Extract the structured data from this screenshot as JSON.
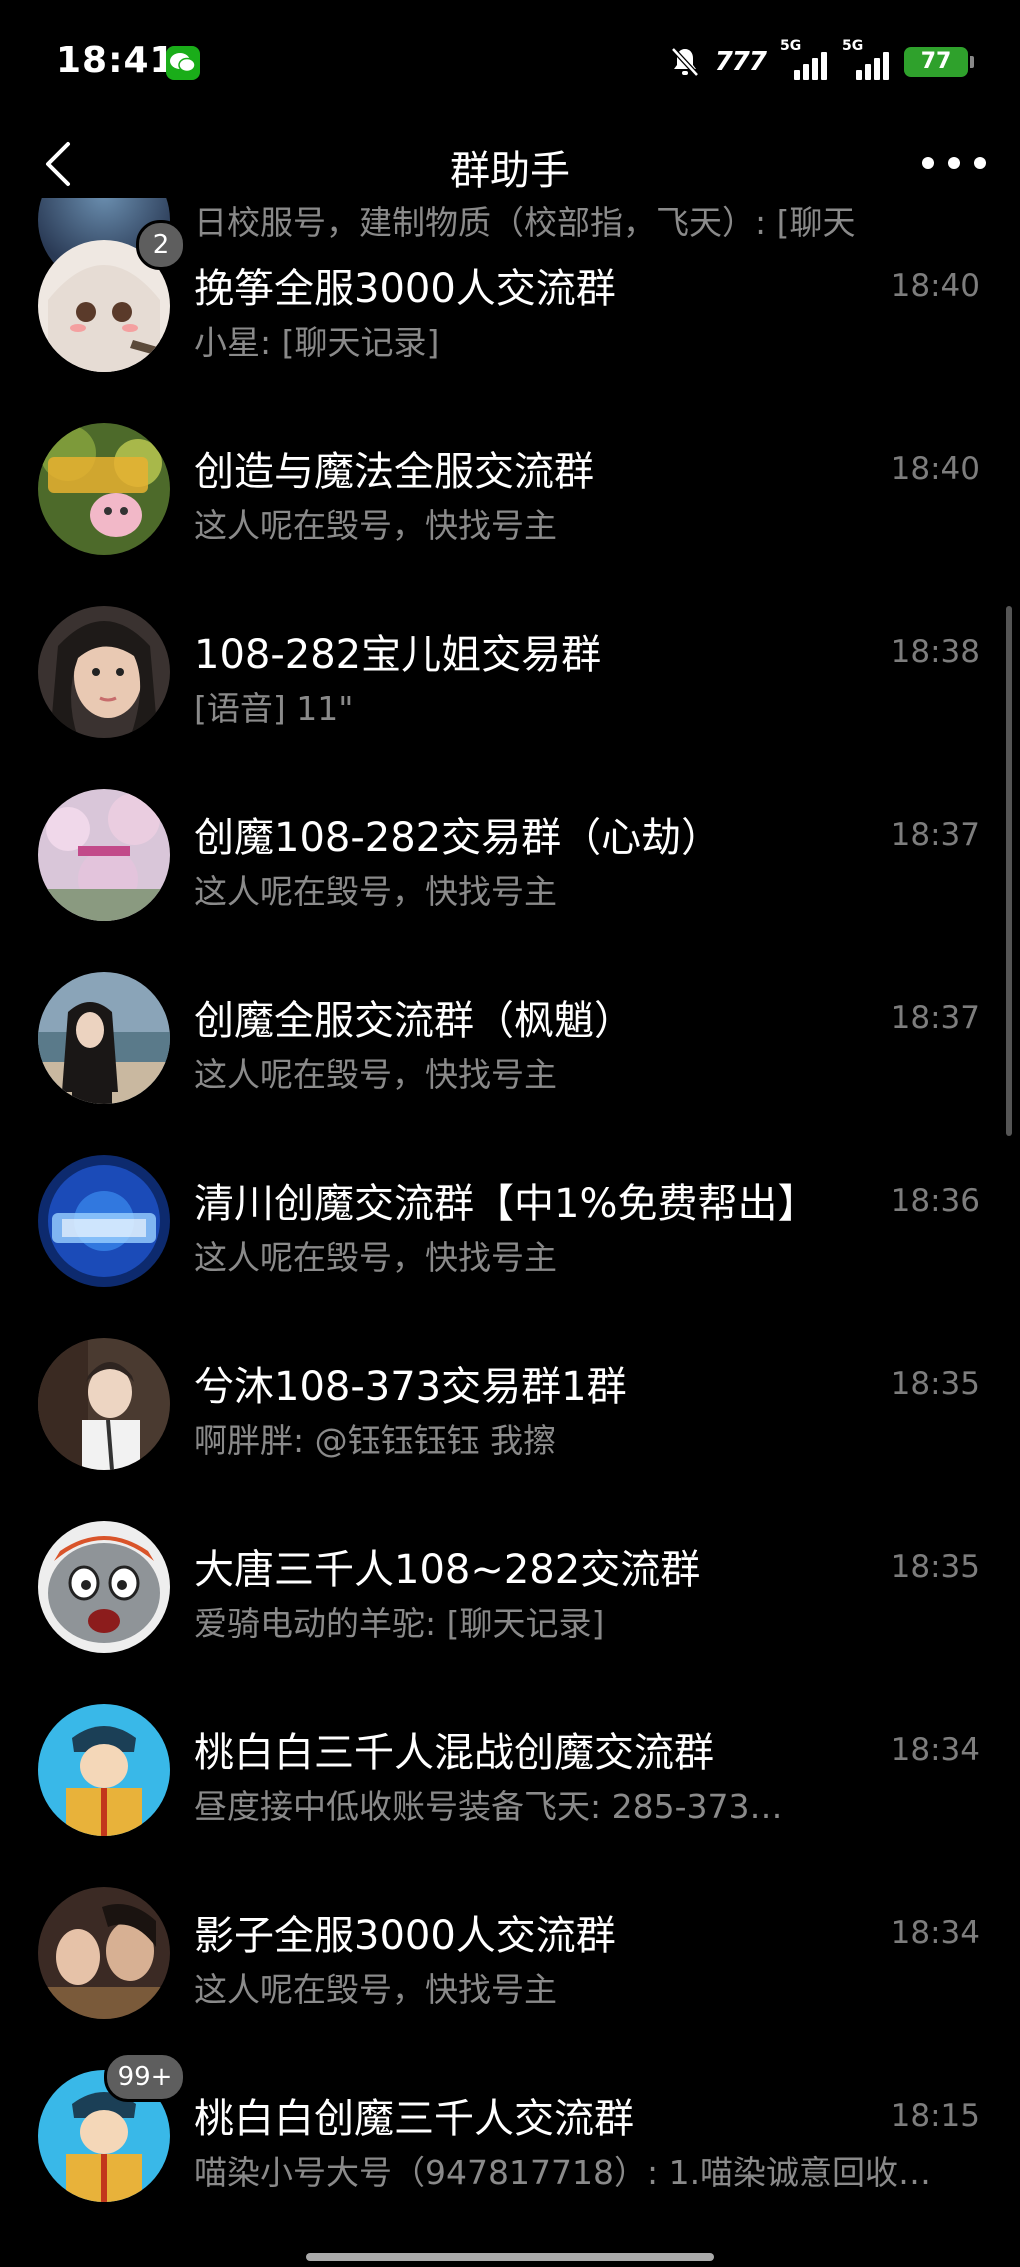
{
  "status_bar": {
    "time": "18:41",
    "network_label_1": "5G",
    "network_label_2": "5G",
    "hd_label": "777",
    "battery": "77"
  },
  "nav": {
    "title": "群助手"
  },
  "partial_preview": "日校服号，建制物质（校部指，飞天）: [聊天",
  "chats": [
    {
      "name": "挽筝全服3000人交流群",
      "preview": "小星: [聊天记录]",
      "time": "18:40",
      "badge": "2"
    },
    {
      "name": "创造与魔法全服交流群",
      "preview": "这人呢在毁号，快找号主",
      "time": "18:40",
      "badge": ""
    },
    {
      "name": "108-282宝儿姐交易群",
      "preview": "[语音] 11\"",
      "time": "18:38",
      "badge": ""
    },
    {
      "name": "创魔108-282交易群（心劫）",
      "preview": "这人呢在毁号，快找号主",
      "time": "18:37",
      "badge": ""
    },
    {
      "name": "创魔全服交流群（枫魈）",
      "preview": "这人呢在毁号，快找号主",
      "time": "18:37",
      "badge": ""
    },
    {
      "name": "清川创魔交流群【中1%免费帮出】",
      "preview": "这人呢在毁号，快找号主",
      "time": "18:36",
      "badge": ""
    },
    {
      "name": "兮沐108-373交易群1群",
      "preview": "啊胖胖: @钰钰钰钰 我擦",
      "time": "18:35",
      "badge": ""
    },
    {
      "name": "大唐三千人108~282交流群",
      "preview": "爱骑电动的羊驼: [聊天记录]",
      "time": "18:35",
      "badge": ""
    },
    {
      "name": "桃白白三千人混战创魔交流群",
      "preview": "昼度接中低收账号装备飞天: 285-373…",
      "time": "18:34",
      "badge": ""
    },
    {
      "name": "影子全服3000人交流群",
      "preview": "这人呢在毁号，快找号主",
      "time": "18:34",
      "badge": ""
    },
    {
      "name": "桃白白创魔三千人交流群",
      "preview": "喵染小号大号（947817718）: 1.喵染诚意回收…",
      "time": "18:15",
      "badge": "99+"
    }
  ]
}
